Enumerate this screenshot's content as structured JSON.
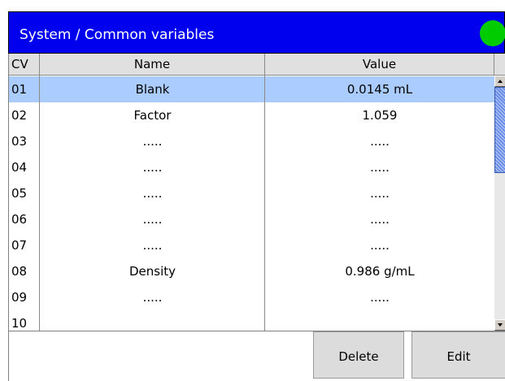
{
  "header": {
    "title": "System / Common variables",
    "status_color": "#00cc00",
    "bar_color": "#0000ee"
  },
  "table": {
    "columns": {
      "cv": "CV",
      "name": "Name",
      "value": "Value"
    },
    "rows": [
      {
        "cv": "01",
        "name": "Blank",
        "value": "0.0145 mL",
        "selected": true
      },
      {
        "cv": "02",
        "name": "Factor",
        "value": "1.059"
      },
      {
        "cv": "03",
        "name": ".....",
        "value": "....."
      },
      {
        "cv": "04",
        "name": ".....",
        "value": "....."
      },
      {
        "cv": "05",
        "name": ".....",
        "value": "....."
      },
      {
        "cv": "06",
        "name": ".....",
        "value": "....."
      },
      {
        "cv": "07",
        "name": ".....",
        "value": "....."
      },
      {
        "cv": "08",
        "name": "Density",
        "value": "0.986 g/mL"
      },
      {
        "cv": "09",
        "name": ".....",
        "value": "....."
      },
      {
        "cv": "10",
        "name": "",
        "value": ""
      }
    ],
    "selected_color": "#aaccff"
  },
  "buttons": {
    "delete_label": "Delete",
    "edit_label": "Edit"
  }
}
